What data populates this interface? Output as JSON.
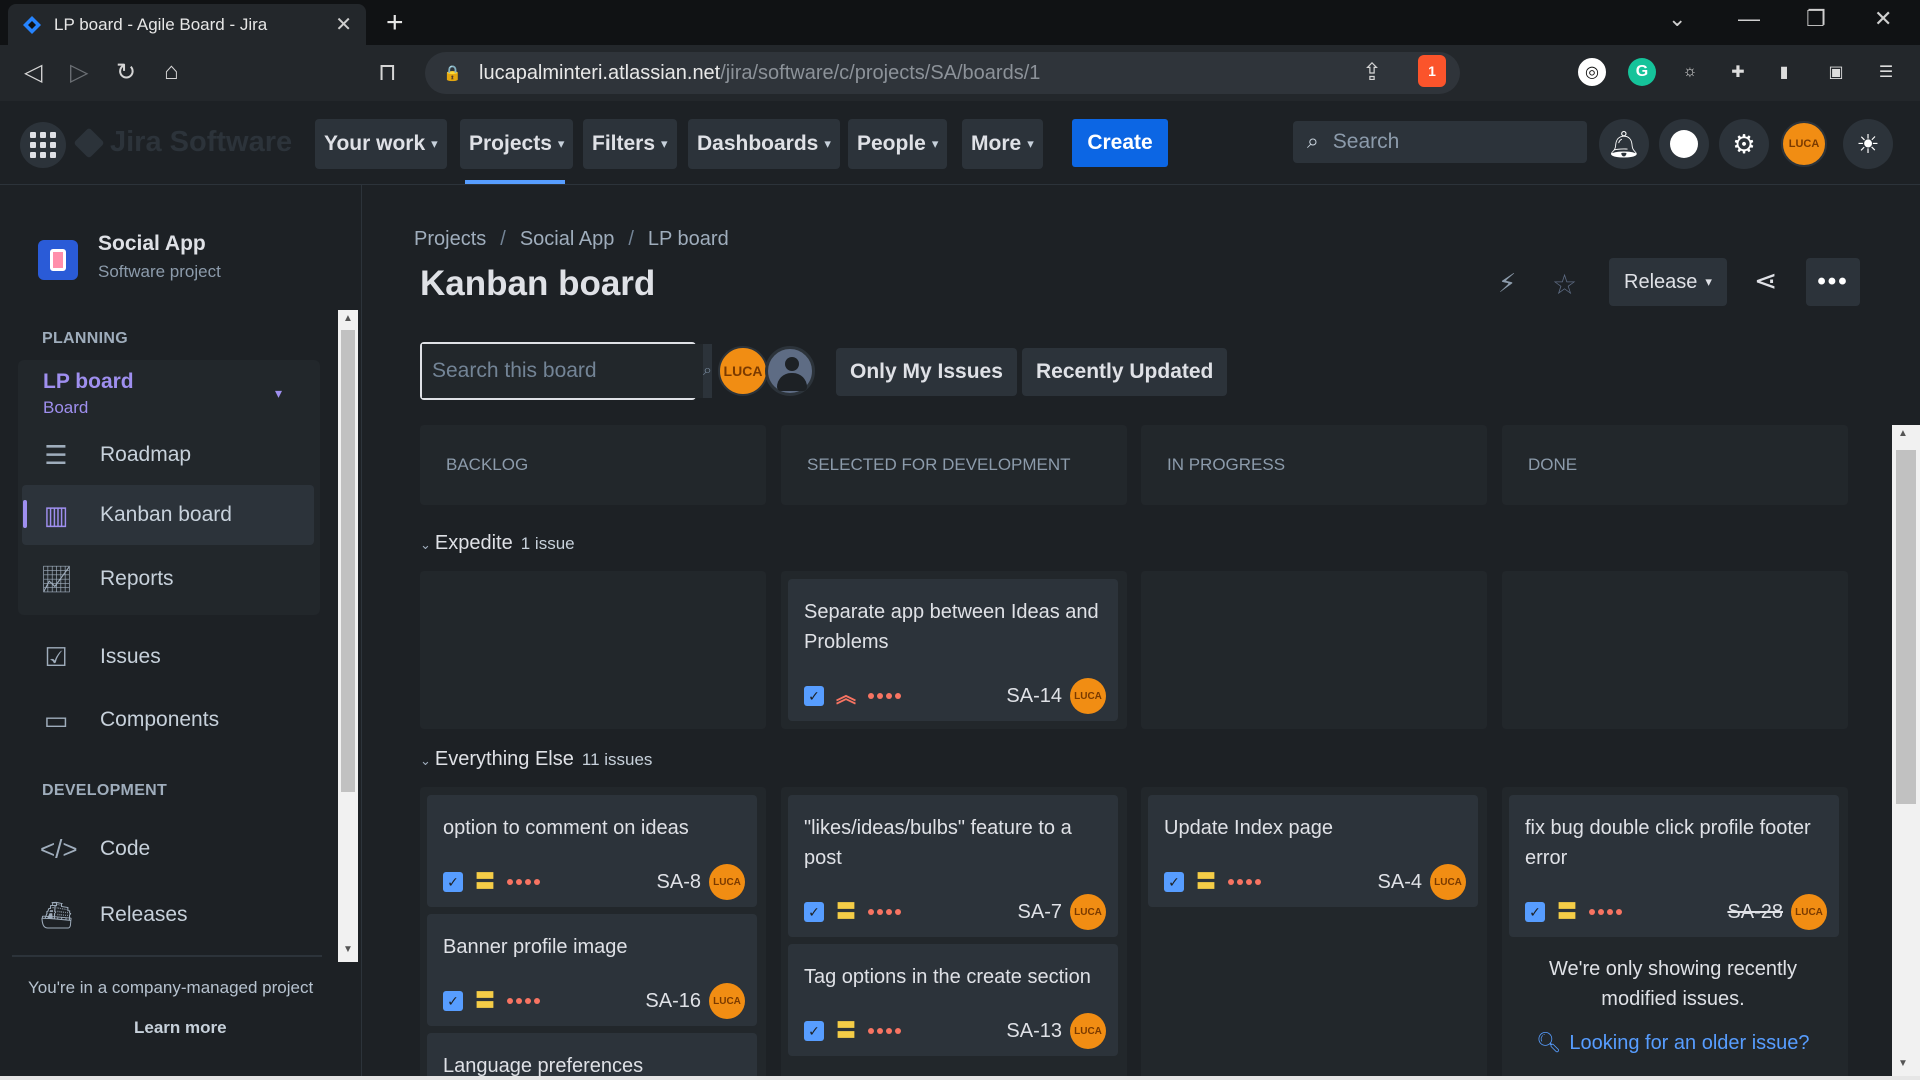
{
  "browser": {
    "tab_title": "LP board - Agile Board - Jira",
    "url_host": "lucapalminteri.atlassian.net",
    "url_path": "/jira/software/c/projects/SA/boards/1",
    "brave_badge": "1"
  },
  "topnav": {
    "product": "Jira Software",
    "items": [
      {
        "label": "Your work"
      },
      {
        "label": "Projects"
      },
      {
        "label": "Filters"
      },
      {
        "label": "Dashboards"
      },
      {
        "label": "People"
      },
      {
        "label": "More"
      }
    ],
    "create_label": "Create",
    "search_placeholder": "Search",
    "avatar_text": "LUCA"
  },
  "sidebar": {
    "project_name": "Social App",
    "project_type": "Software project",
    "planning_heading": "PLANNING",
    "board_name": "LP board",
    "board_sub": "Board",
    "planning_items": [
      {
        "label": "Roadmap",
        "icon": "roadmap-icon"
      },
      {
        "label": "Kanban board",
        "icon": "board-icon"
      },
      {
        "label": "Reports",
        "icon": "reports-icon"
      }
    ],
    "other_items": [
      {
        "label": "Issues",
        "icon": "issues-icon"
      },
      {
        "label": "Components",
        "icon": "components-icon"
      }
    ],
    "development_heading": "DEVELOPMENT",
    "dev_items": [
      {
        "label": "Code",
        "icon": "code-icon"
      },
      {
        "label": "Releases",
        "icon": "releases-icon"
      }
    ],
    "company_note": "You're in a company-managed project",
    "learn_more": "Learn more"
  },
  "main": {
    "breadcrumb": [
      "Projects",
      "Social App",
      "LP board"
    ],
    "title": "Kanban board",
    "release_label": "Release",
    "board_search_placeholder": "Search this board",
    "avatar_text": "LUCA",
    "filters": [
      "Only My Issues",
      "Recently Updated"
    ],
    "columns": [
      "BACKLOG",
      "SELECTED FOR DEVELOPMENT",
      "IN PROGRESS",
      "DONE"
    ],
    "lanes": [
      {
        "name": "Expedite",
        "count": "1 issue"
      },
      {
        "name": "Everything Else",
        "count": "11 issues"
      }
    ],
    "cards": {
      "sa14": {
        "title": "Separate app between Ideas and Problems",
        "key": "SA-14"
      },
      "sa8": {
        "title": "option to comment on ideas",
        "key": "SA-8"
      },
      "sa16": {
        "title": "Banner profile image",
        "key": "SA-16"
      },
      "lang": {
        "title": "Language preferences"
      },
      "sa7": {
        "title": "\"likes/ideas/bulbs\" feature to a post",
        "key": "SA-7"
      },
      "sa13": {
        "title": "Tag options in the create section",
        "key": "SA-13"
      },
      "sa4": {
        "title": "Update Index page",
        "key": "SA-4"
      },
      "sa28": {
        "title": "fix bug double click profile footer error",
        "key": "SA-28"
      }
    },
    "older_note": "We're only showing recently modified issues.",
    "older_link": "Looking for an older issue?"
  },
  "colors": {
    "accent": "#0c66e4",
    "brand_purple": "#9f8fef",
    "avatar_orange": "#f18d13",
    "link": "#579dff"
  }
}
